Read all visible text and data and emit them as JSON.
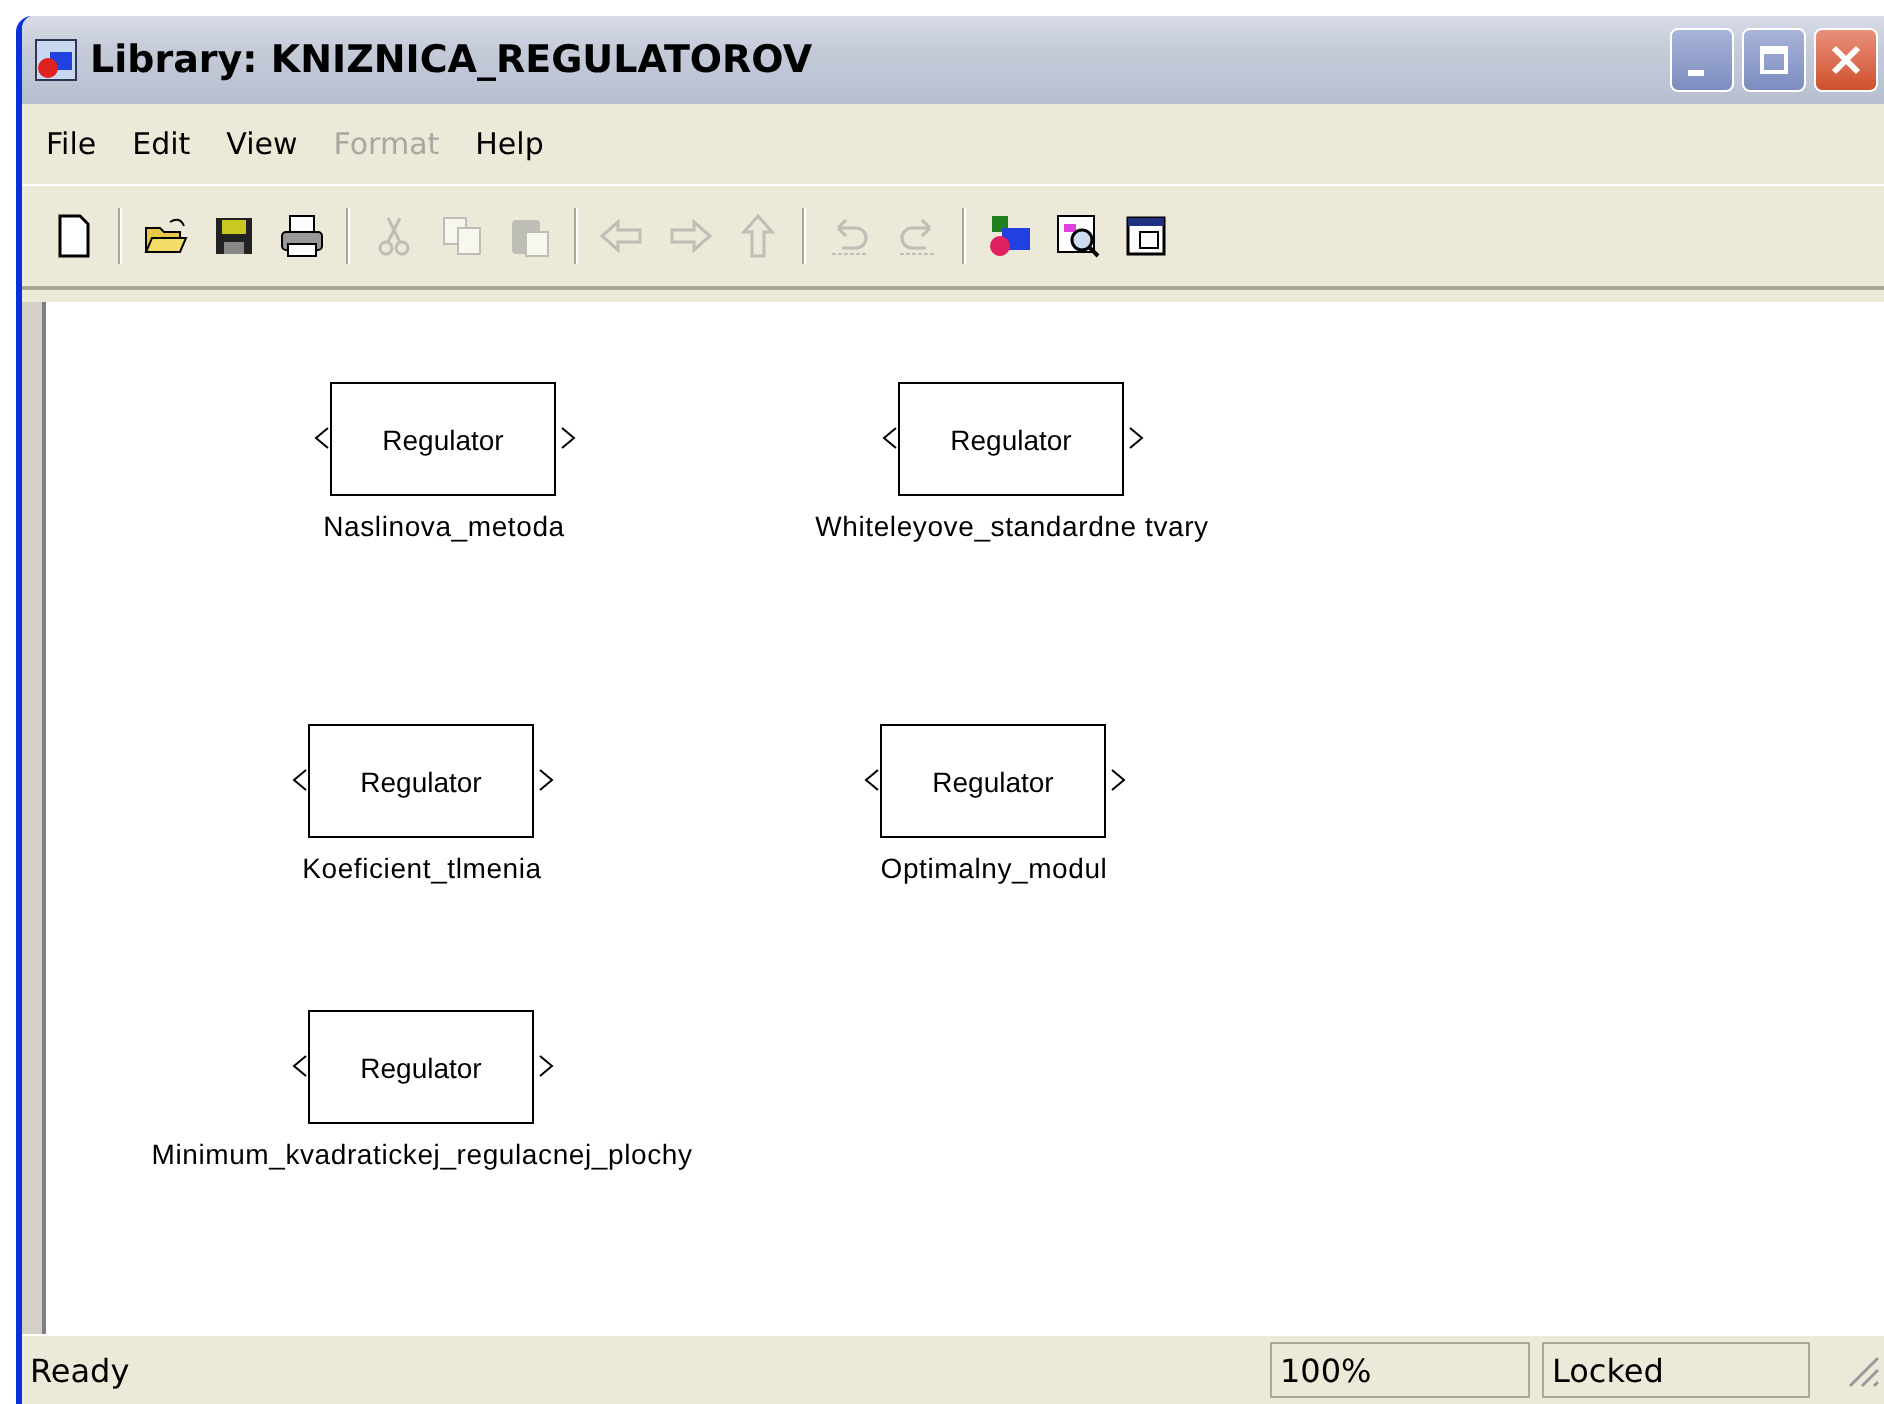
{
  "window": {
    "title": "Library: KNIZNICA_REGULATOROV"
  },
  "menu": [
    {
      "label": "File",
      "disabled": false
    },
    {
      "label": "Edit",
      "disabled": false
    },
    {
      "label": "View",
      "disabled": false
    },
    {
      "label": "Format",
      "disabled": true
    },
    {
      "label": "Help",
      "disabled": false
    }
  ],
  "toolbar": [
    {
      "kind": "new",
      "disabled": false
    },
    {
      "kind": "separator"
    },
    {
      "kind": "open",
      "disabled": false
    },
    {
      "kind": "save",
      "disabled": false
    },
    {
      "kind": "print",
      "disabled": false
    },
    {
      "kind": "separator"
    },
    {
      "kind": "cut",
      "disabled": true
    },
    {
      "kind": "copy",
      "disabled": true
    },
    {
      "kind": "paste",
      "disabled": true
    },
    {
      "kind": "separator"
    },
    {
      "kind": "back",
      "disabled": true
    },
    {
      "kind": "forward",
      "disabled": true
    },
    {
      "kind": "up",
      "disabled": true
    },
    {
      "kind": "separator"
    },
    {
      "kind": "undo",
      "disabled": true
    },
    {
      "kind": "redo",
      "disabled": true
    },
    {
      "kind": "separator"
    },
    {
      "kind": "library",
      "disabled": false
    },
    {
      "kind": "browser",
      "disabled": false
    },
    {
      "kind": "properties",
      "disabled": false
    }
  ],
  "blocks": [
    {
      "title": "Regulator",
      "name": "Naslinova_metoda"
    },
    {
      "title": "Regulator",
      "name": "Whiteleyove_standardne tvary"
    },
    {
      "title": "Regulator",
      "name": "Koeficient_tlmenia"
    },
    {
      "title": "Regulator",
      "name": "Optimalny_modul"
    },
    {
      "title": "Regulator",
      "name": "Minimum_kvadratickej_regulacnej_plochy"
    }
  ],
  "status_bar": {
    "message": "Ready",
    "zoom": "100%",
    "mode": "Locked"
  }
}
